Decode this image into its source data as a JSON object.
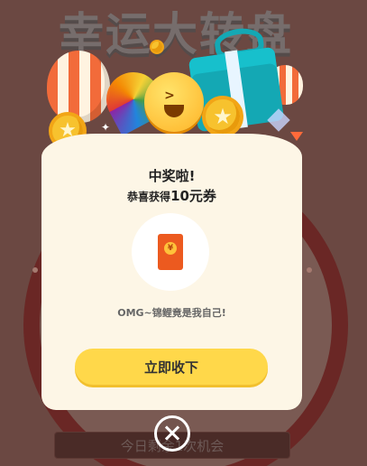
{
  "background": {
    "title": "幸运大转盘",
    "chance_text": "今日剩余1次机会"
  },
  "modal": {
    "title": "中奖啦!",
    "subtitle_prefix": "恭喜获得",
    "prize_amount": "10元券",
    "prize_icon": "red-envelope-icon",
    "prize_icon_glyph": "¥",
    "message": "OMG~锦鲤竟是我自己!",
    "claim_label": "立即收下",
    "close_icon": "close-icon"
  },
  "colors": {
    "page_bg": "#6b4842",
    "card_bg": "#fdf6e6",
    "button_bg": "#ffd84a",
    "accent_red": "#ec5a1f"
  }
}
